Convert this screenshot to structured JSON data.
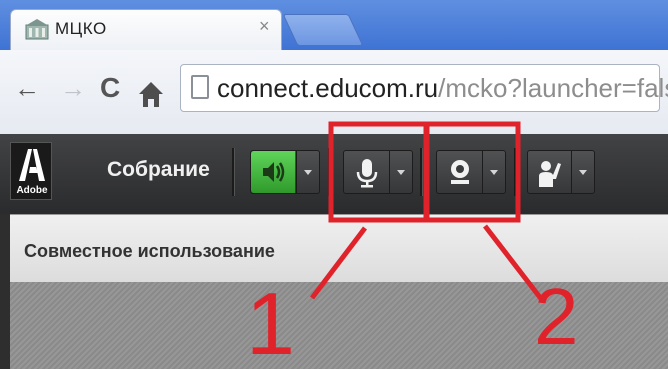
{
  "browser": {
    "tab_title": "МЦКО",
    "tab_close": "×",
    "url_host": "connect.educom.ru",
    "url_path": "/mcko?launcher=false"
  },
  "nav_icons": {
    "back": "←",
    "forward": "→",
    "reload": "C",
    "home": "home-icon"
  },
  "connect_bar": {
    "logo_text": "Adobe",
    "meeting_label": "Собрание",
    "buttons": [
      {
        "name": "speaker",
        "icon": "speaker-icon",
        "active": true
      },
      {
        "name": "microphone",
        "icon": "microphone-icon",
        "active": false
      },
      {
        "name": "camera",
        "icon": "webcam-icon",
        "active": false
      },
      {
        "name": "raise-hand",
        "icon": "raise-hand-icon",
        "active": false
      }
    ]
  },
  "pod": {
    "title": "Совместное использование"
  },
  "annotations": {
    "label_1": "1",
    "label_2": "2",
    "color": "#e0222b"
  },
  "colors": {
    "chrome_blue": "#3f73d4",
    "connect_dark": "#2a2b2d",
    "speaker_green": "#3fbf3a"
  }
}
